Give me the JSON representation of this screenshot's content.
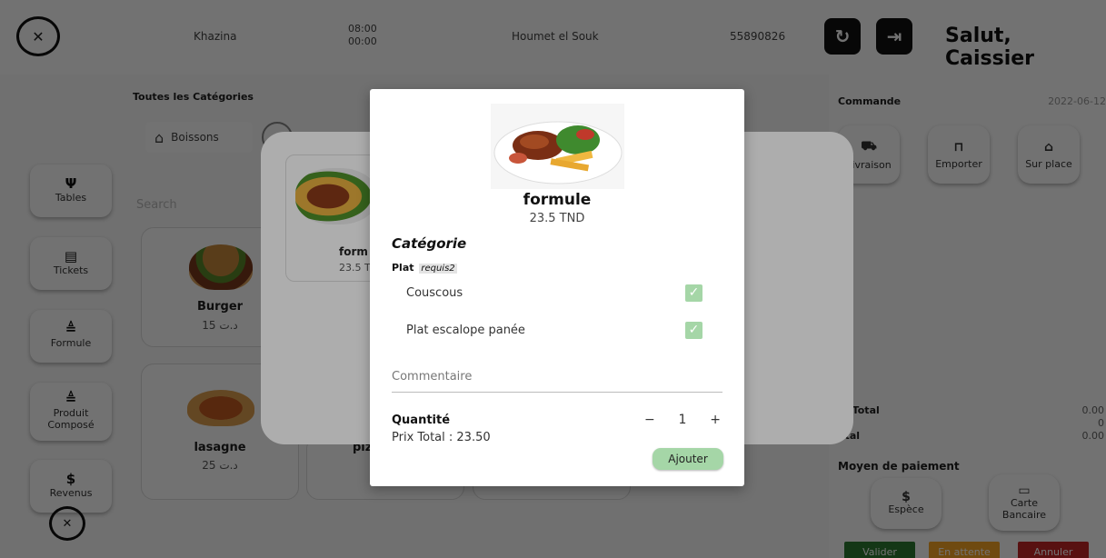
{
  "topbar": {
    "logo_text": "✕",
    "store": "Khazina",
    "time_open": "08:00",
    "time_close": "00:00",
    "location": "Houmet el Souk",
    "phone": "55890826",
    "refresh_icon": "refresh-icon",
    "logout_icon": "logout-icon",
    "greeting": "Salut, Caissier"
  },
  "sidebar": {
    "items": [
      {
        "icon": "Ψ",
        "label": "Tables"
      },
      {
        "icon": "▤",
        "label": "Tickets"
      },
      {
        "icon": "≜",
        "label": "Formule"
      },
      {
        "icon": "≜",
        "label": "Produit Composé"
      },
      {
        "icon": "$",
        "label": "Revenus"
      }
    ]
  },
  "catalog": {
    "title": "Toutes les Catégories",
    "category_chip": "Boissons",
    "search_placeholder": "Search",
    "products": [
      {
        "name": "Burger",
        "price": "15 د.ت"
      },
      {
        "name": "lasagne",
        "price": "25 د.ت"
      },
      {
        "name": "pizz",
        "price": ""
      }
    ]
  },
  "formule_dialog": {
    "card_name": "form",
    "card_price": "23.5 T"
  },
  "order": {
    "title": "Commande",
    "date": "2022-06-12",
    "modes": [
      "Livraison",
      "Emporter",
      "Sur place"
    ],
    "totals": [
      {
        "label": "ubTotal",
        "value": "0.00"
      },
      {
        "label": "ax",
        "value": "0"
      },
      {
        "label": "otal",
        "value": "0.00"
      }
    ],
    "payment_title": "Moyen de paiement",
    "payments": [
      "Espèce",
      "Carte Bancaire"
    ],
    "actions": [
      "Valider",
      "En attente",
      "Annuler"
    ],
    "colors": {
      "valider": "#2e7d32",
      "attente": "#f9a825",
      "annuler": "#c62828"
    }
  },
  "modal": {
    "title": "formule",
    "price": "23.5 TND",
    "category_heading": "Catégorie",
    "group_label": "Plat",
    "group_required": "requis2",
    "options": [
      {
        "label": "Couscous",
        "checked": true
      },
      {
        "label": "Plat escalope panée",
        "checked": true
      }
    ],
    "comment_placeholder": "Commentaire",
    "quantity_label": "Quantité",
    "quantity": "1",
    "minus": "−",
    "plus": "+",
    "total_text": "Prix Total : 23.50",
    "add_button": "Ajouter",
    "accent_color": "#a5d6a7"
  }
}
